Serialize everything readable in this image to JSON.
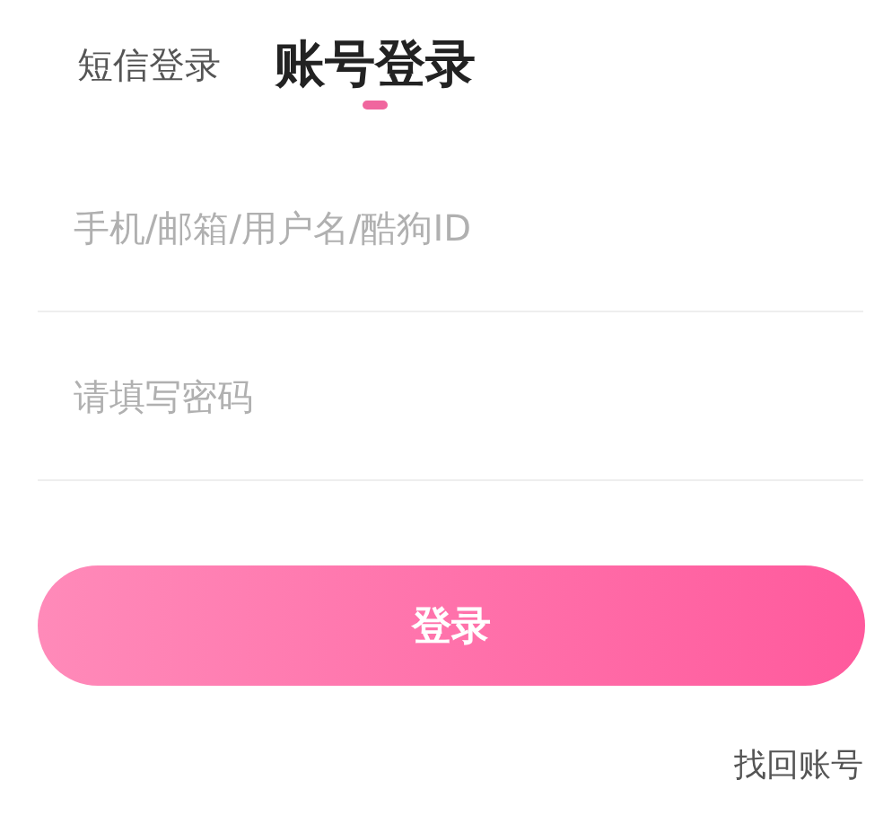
{
  "tabs": [
    {
      "label": "短信登录",
      "selected": false
    },
    {
      "label": "账号登录",
      "selected": true
    }
  ],
  "fields": [
    {
      "placeholder": "手机/邮箱/用户名/酷狗ID"
    },
    {
      "placeholder": "请填写密码"
    }
  ],
  "login_button": {
    "label": "登录"
  },
  "recover_link": {
    "label": "找回账号"
  }
}
